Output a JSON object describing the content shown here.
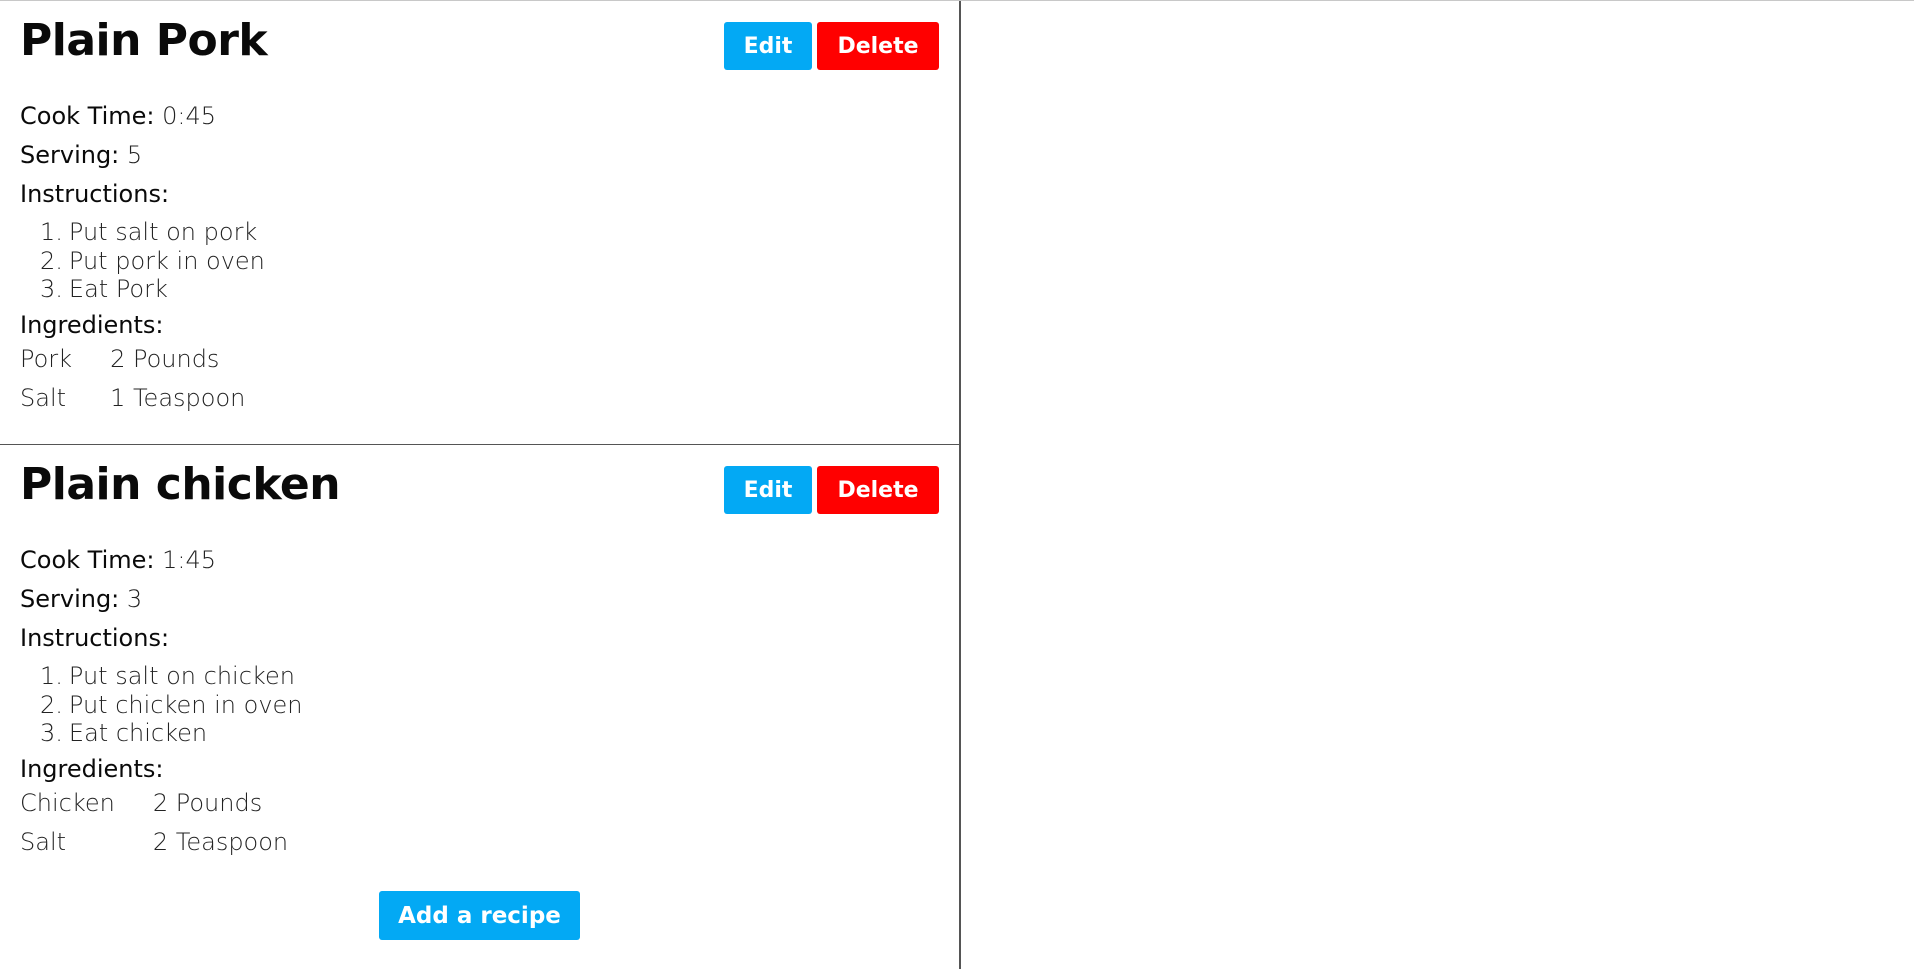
{
  "colors": {
    "edit_button": "#03a9f4",
    "delete_button": "#ff0000",
    "add_button": "#03a9f4",
    "divider": "#555555"
  },
  "labels": {
    "cook_time": "Cook Time:",
    "serving": "Serving:",
    "instructions": "Instructions:",
    "ingredients": "Ingredients:",
    "edit": "Edit",
    "delete": "Delete",
    "add_recipe": "Add a recipe"
  },
  "recipes": [
    {
      "title": "Plain Pork",
      "cook_time": "0:45",
      "serving": "5",
      "instructions": [
        {
          "num": "1.",
          "text": "Put salt on pork"
        },
        {
          "num": "2.",
          "text": "Put pork in oven"
        },
        {
          "num": "3.",
          "text": "Eat Pork"
        }
      ],
      "ingredients": [
        {
          "name": "Pork",
          "amount": "2 Pounds"
        },
        {
          "name": "Salt",
          "amount": "1 Teaspoon"
        }
      ]
    },
    {
      "title": "Plain chicken",
      "cook_time": "1:45",
      "serving": "3",
      "instructions": [
        {
          "num": "1.",
          "text": "Put salt on chicken"
        },
        {
          "num": "2.",
          "text": "Put chicken in oven"
        },
        {
          "num": "3.",
          "text": "Eat chicken"
        }
      ],
      "ingredients": [
        {
          "name": "Chicken",
          "amount": "2 Pounds"
        },
        {
          "name": "Salt",
          "amount": "2 Teaspoon"
        }
      ]
    }
  ]
}
